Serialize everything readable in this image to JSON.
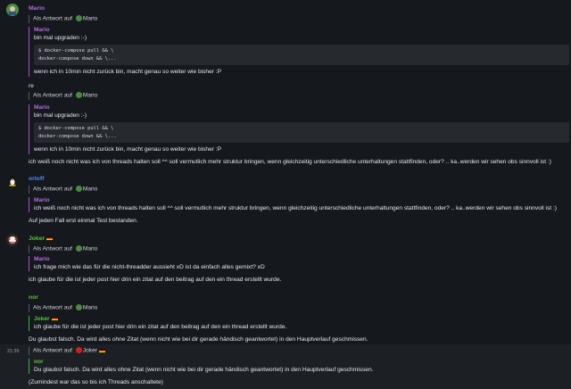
{
  "reply_prefix": "Als Antwort auf",
  "colors": {
    "mario": "#b06bd9",
    "orloff": "#4b90e6",
    "joker": "#59c13c",
    "quote_border_purple": "#a256c6",
    "quote_border_green": "#36b34a",
    "bg": "#15191e"
  },
  "m1": {
    "sender": "Mario",
    "reply_to": "Mario",
    "quote_name": "Mario",
    "quote_text": "bin mal upgraden :-)",
    "code_line1": "$ docker-compose pull && \\",
    "code_line2": "docker-compose down && \\...",
    "quote_after": "wenn ich in 10min nicht zurück bin, macht genau so weiter wie bisher :P"
  },
  "m2": {
    "text": "re",
    "reply_to": "Mario",
    "quote_name": "Mario",
    "quote_text": "bin mal upgraden :-)",
    "code_line1": "$ docker-compose pull && \\",
    "code_line2": "docker-compose down && \\...",
    "quote_after": "wenn ich in 10min nicht zurück bin, macht genau so weiter wie bisher :P",
    "followup": "ich weiß noch nicht was ich von threads halten soll ^^ soll vermutlich mehr struktur bringen, wenn gleichzeitig unterschiedliche unterhaltungen stattfinden, oder? .. ka..werden wir sehen obs sinnvoll ist :)"
  },
  "m3": {
    "sender": "orloff",
    "reply_to": "Mario",
    "quote_name": "Mario",
    "quote_text": "ich weiß noch nicht was ich von threads halten soll ^^ soll vermutlich mehr struktur bringen, wenn gleichzeitig unterschiedliche unterhaltungen stattfinden, oder? .. ka..werden wir sehen obs sinnvoll ist :)",
    "text": "Auf jeden Fall erst einmal Test bestanden."
  },
  "m4": {
    "sender": "Joker",
    "reply_to": "Mario",
    "quote_name": "Mario",
    "quote_text": "ich frage mich wie das für die nicht-threadder aussieht xD ist da einfach alles gemixt? xD",
    "text": "ich glaube für die ist jeder post hier drin ein zitat auf den beitrag auf den ein thread erstellt wurde."
  },
  "m5": {
    "sender": "nor",
    "reply_to": "Mario",
    "quote_name": "Joker",
    "quote_text": "ich glaube für die ist jeder post hier drin ein zitat auf den beitrag auf den ein thread erstellt wurde.",
    "text_before": "Du glaubst falsch. Da wird alles ",
    "text_em": "ohne",
    "text_after": " Zitat (wenn nicht wie bei dir gerade händisch geantwortet) in den Hauptverlauf geschmissen."
  },
  "m6": {
    "timestamp": "21:35",
    "reply_to": "Joker",
    "quote_name": "nor",
    "quote_text": "Du glaubst falsch. Da wird alles ohne Zitat (wenn nicht wie bei dir gerade händisch geantwortet) in den Hauptverlauf geschmissen.",
    "text": "(Zumindest war das so bis ich Threads anschaltete)"
  }
}
